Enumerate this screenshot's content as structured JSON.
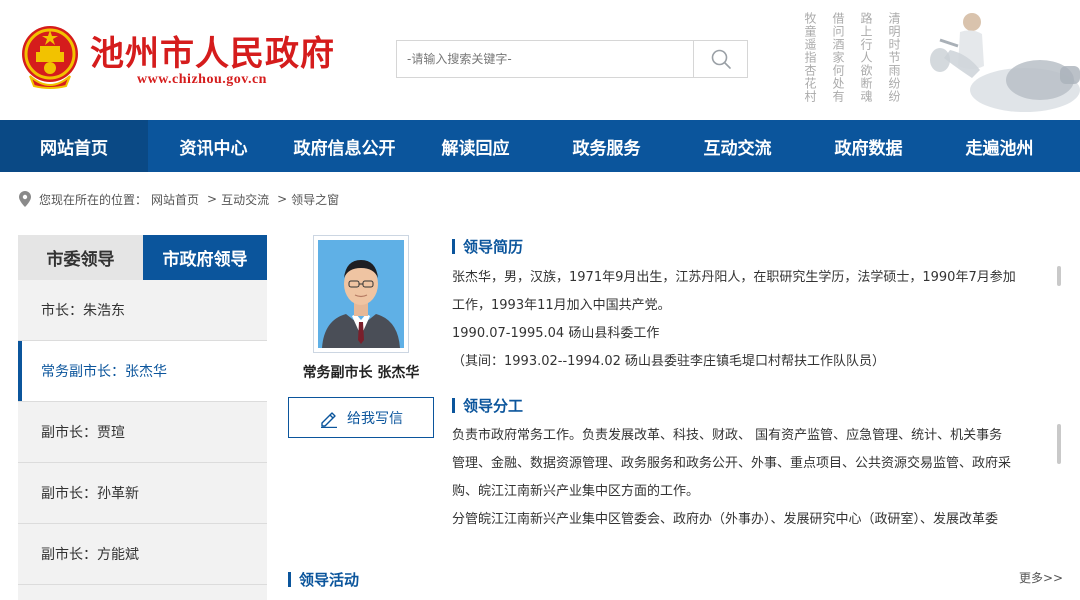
{
  "header": {
    "title": "池州市人民政府",
    "url": "www.chizhou.gov.cn",
    "search_placeholder": "-请输入搜索关键字-",
    "poem": [
      "清明时节雨纷纷",
      "路上行人欲断魂",
      "借问酒家何处有",
      "牧童遥指杏花村"
    ]
  },
  "nav": {
    "items": [
      "网站首页",
      "资讯中心",
      "政府信息公开",
      "解读回应",
      "政务服务",
      "互动交流",
      "政府数据",
      "走遍池州"
    ]
  },
  "breadcrumb": {
    "prefix": "您现在所在的位置：",
    "items": [
      "网站首页",
      "互动交流",
      "领导之窗"
    ],
    "separator": ">"
  },
  "sidebar": {
    "tabs": [
      "市委领导",
      "市政府领导"
    ],
    "items": [
      "市长：朱浩东",
      "常务副市长：张杰华",
      "副市长：贾瑄",
      "副市长：孙革新",
      "副市长：方能斌"
    ]
  },
  "profile": {
    "caption": "常务副市长 张杰华",
    "letter_button": "给我写信"
  },
  "resume": {
    "title": "领导简历",
    "lines": [
      "张杰华，男，汉族，1971年9月出生，江苏丹阳人，在职研究生学历，法学硕士，1990年7月参加",
      "工作，1993年11月加入中国共产党。",
      "1990.07-1995.04 砀山县科委工作",
      "（其间：1993.02--1994.02 砀山县委驻李庄镇毛堤口村帮扶工作队队员）"
    ]
  },
  "duties": {
    "title": "领导分工",
    "lines": [
      "负责市政府常务工作。负责发展改革、科技、财政、 国有资产监管、应急管理、统计、机关事务",
      "管理、金融、数据资源管理、政务服务和政务公开、外事、重点项目、公共资源交易监管、政府采",
      "购、皖江江南新兴产业集中区方面的工作。",
      "分管皖江江南新兴产业集中区管委会、政府办（外事办）、发展研究中心（政研室）、发展改革委"
    ]
  },
  "activities": {
    "title": "领导活动",
    "more": "更多>>"
  },
  "colors": {
    "brand_red": "#d51c1c",
    "nav_blue": "#0b559c"
  }
}
